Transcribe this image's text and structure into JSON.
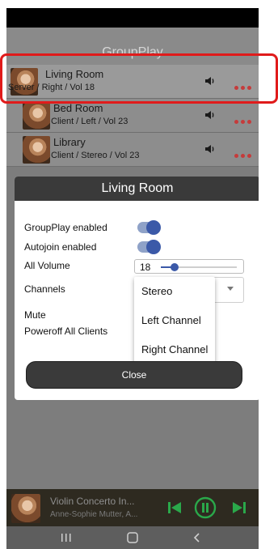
{
  "app": {
    "title": "GroupPlay"
  },
  "rooms": [
    {
      "name": "Living Room",
      "detail": "Server / Right / Vol 18"
    },
    {
      "name": "Bed Room",
      "detail": "Client / Left / Vol 23"
    },
    {
      "name": "Library",
      "detail": "Client / Stereo / Vol 23"
    }
  ],
  "dialog": {
    "title": "Living Room",
    "groupplay_label": "GroupPlay enabled",
    "autojoin_label": "Autojoin enabled",
    "all_volume_label": "All Volume",
    "all_volume_value": "18",
    "all_volume_level": 0.18,
    "channels_label": "Channels",
    "mute_label": "Mute",
    "poweroff_label": "Poweroff All Clients",
    "close_label": "Close",
    "channel_options": [
      "Stereo",
      "Left Channel",
      "Right Channel"
    ]
  },
  "now_playing": {
    "title": "Violin Concerto In...",
    "artist": "Anne-Sophie Mutter, A..."
  },
  "colors": {
    "accent": "#3b59a8",
    "more_dots": "#c53b3b",
    "player_controls": "#2aa84a",
    "highlight": "#e01b1b"
  }
}
